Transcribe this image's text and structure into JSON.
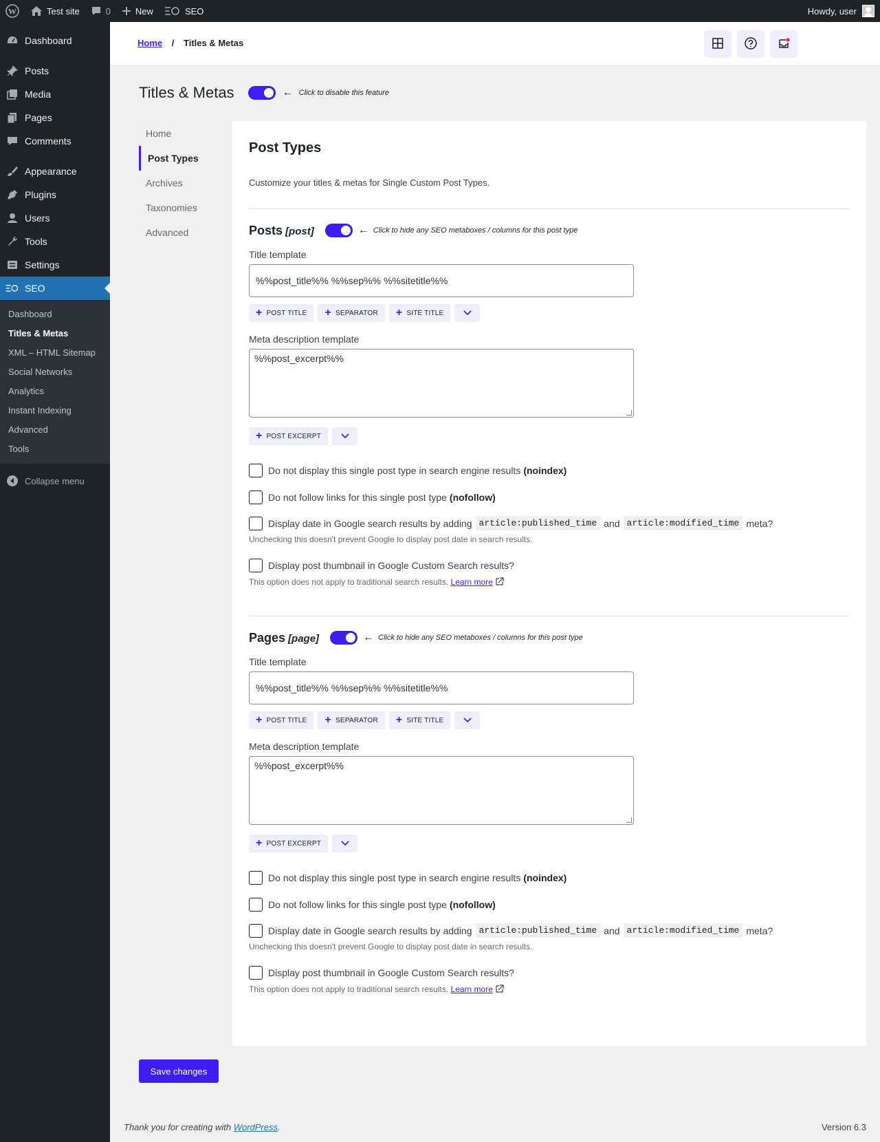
{
  "adminbar": {
    "site_name": "Test site",
    "comments_count": "0",
    "new_label": "New",
    "seo_label": "SEO",
    "howdy": "Howdy, user"
  },
  "sidebar": {
    "items": [
      {
        "label": "Dashboard",
        "icon": "dashboard-icon"
      },
      {
        "label": "Posts",
        "icon": "pin-icon"
      },
      {
        "label": "Media",
        "icon": "media-icon"
      },
      {
        "label": "Pages",
        "icon": "pages-icon"
      },
      {
        "label": "Comments",
        "icon": "comment-icon"
      },
      {
        "label": "Appearance",
        "icon": "brush-icon"
      },
      {
        "label": "Plugins",
        "icon": "plugin-icon"
      },
      {
        "label": "Users",
        "icon": "user-icon"
      },
      {
        "label": "Tools",
        "icon": "wrench-icon"
      },
      {
        "label": "Settings",
        "icon": "settings-icon"
      },
      {
        "label": "SEO",
        "icon": "seo-icon"
      }
    ],
    "submenu": [
      "Dashboard",
      "Titles & Metas",
      "XML – HTML Sitemap",
      "Social Networks",
      "Analytics",
      "Instant Indexing",
      "Advanced",
      "Tools"
    ],
    "collapse": "Collapse menu"
  },
  "breadcrumb": {
    "home": "Home",
    "sep": "/",
    "current": "Titles & Metas"
  },
  "page": {
    "title": "Titles & Metas",
    "feature_hint": "Click to disable this feature"
  },
  "subnav": [
    "Home",
    "Post Types",
    "Archives",
    "Taxonomies",
    "Advanced"
  ],
  "card": {
    "heading": "Post Types",
    "description": "Customize your titles & metas for Single Custom Post Types."
  },
  "sections": [
    {
      "name": "Posts",
      "slug": "[post]",
      "hint": "Click to hide any SEO metaboxes / columns for this post type",
      "title_label": "Title template",
      "title_value": "%%post_title%% %%sep%% %%sitetitle%%",
      "title_tags": [
        "POST TITLE",
        "SEPARATOR",
        "SITE TITLE"
      ],
      "meta_label": "Meta description template",
      "meta_value": "%%post_excerpt%%",
      "meta_tags": [
        "POST EXCERPT"
      ],
      "noindex_text": "Do not display this single post type in search engine results",
      "noindex_bold": "(noindex)",
      "nofollow_text": "Do not follow links for this single post type",
      "nofollow_bold": "(nofollow)",
      "date_pre": "Display date in Google search results by adding",
      "date_code1": "article:published_time",
      "date_and": "and",
      "date_code2": "article:modified_time",
      "date_post": "meta?",
      "date_note": "Unchecking this doesn't prevent Google to display post date in search results.",
      "thumb_text": "Display post thumbnail in Google Custom Search results?",
      "thumb_note": "This option does not apply to traditional search results.",
      "learn_more": "Learn more"
    },
    {
      "name": "Pages",
      "slug": "[page]",
      "hint": "Click to hide any SEO metaboxes / columns for this post type",
      "title_label": "Title template",
      "title_value": "%%post_title%% %%sep%% %%sitetitle%%",
      "title_tags": [
        "POST TITLE",
        "SEPARATOR",
        "SITE TITLE"
      ],
      "meta_label": "Meta description template",
      "meta_value": "%%post_excerpt%%",
      "meta_tags": [
        "POST EXCERPT"
      ],
      "noindex_text": "Do not display this single post type in search engine results",
      "noindex_bold": "(noindex)",
      "nofollow_text": "Do not follow links for this single post type",
      "nofollow_bold": "(nofollow)",
      "date_pre": "Display date in Google search results by adding",
      "date_code1": "article:published_time",
      "date_and": "and",
      "date_code2": "article:modified_time",
      "date_post": "meta?",
      "date_note": "Unchecking this doesn't prevent Google to display post date in search results.",
      "thumb_text": "Display post thumbnail in Google Custom Search results?",
      "thumb_note": "This option does not apply to traditional search results.",
      "learn_more": "Learn more"
    }
  ],
  "save_label": "Save changes",
  "footer": {
    "thanks_pre": "Thank you for creating with",
    "thanks_link": "WordPress",
    "thanks_post": ".",
    "version": "Version 6.3"
  },
  "colors": {
    "accent": "#3c1ff0",
    "wp_blue": "#2271b1",
    "sidebar_bg": "#1d2327"
  }
}
